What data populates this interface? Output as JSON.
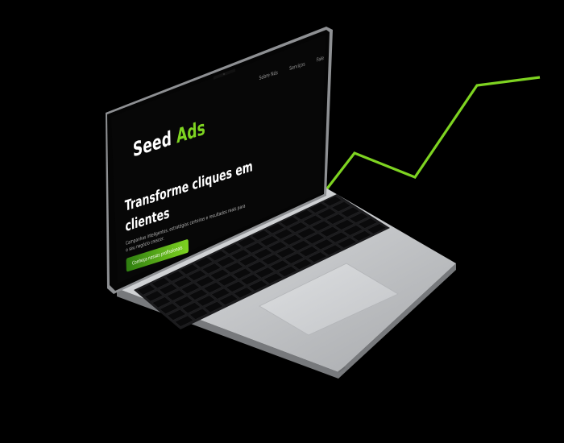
{
  "site": {
    "logo_main": "Seed",
    "logo_accent": "Ads",
    "nav": [
      "Sobre Nós",
      "Serviços",
      "Fale"
    ],
    "hero_title": "Transforme cliques em clientes",
    "hero_subtitle": "Campanhas inteligentes, estratégias certeiras e resultados reais para o seu negócio crescer.",
    "cta_label": "Conheça nossos profissionais"
  },
  "colors": {
    "accent": "#7ed321",
    "background": "#000000",
    "laptop_body": "#c9cbce"
  },
  "icons": [
    "growth-arrow-line",
    "keyboard",
    "trackpad"
  ]
}
